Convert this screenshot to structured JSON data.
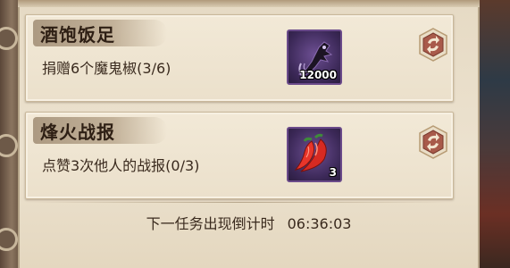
{
  "tasks": [
    {
      "title": "酒饱饭足",
      "description": "捐赠6个魔鬼椒(3/6)",
      "reward": {
        "icon": "dark-claw-item-icon",
        "count": "12000"
      },
      "refresh_icon": "refresh-icon"
    },
    {
      "title": "烽火战报",
      "description": "点赞3次他人的战报(0/3)",
      "reward": {
        "icon": "red-chili-pepper-icon",
        "count": "3"
      },
      "refresh_icon": "refresh-icon"
    }
  ],
  "countdown": {
    "label": "下一任务出现倒计时",
    "time": "06:36:03"
  },
  "colors": {
    "panel_bg": "#ece2cf",
    "card_bg": "#f2e9d7",
    "item_frame": "#6a4a8a",
    "refresh_badge": "#a85a4a"
  }
}
